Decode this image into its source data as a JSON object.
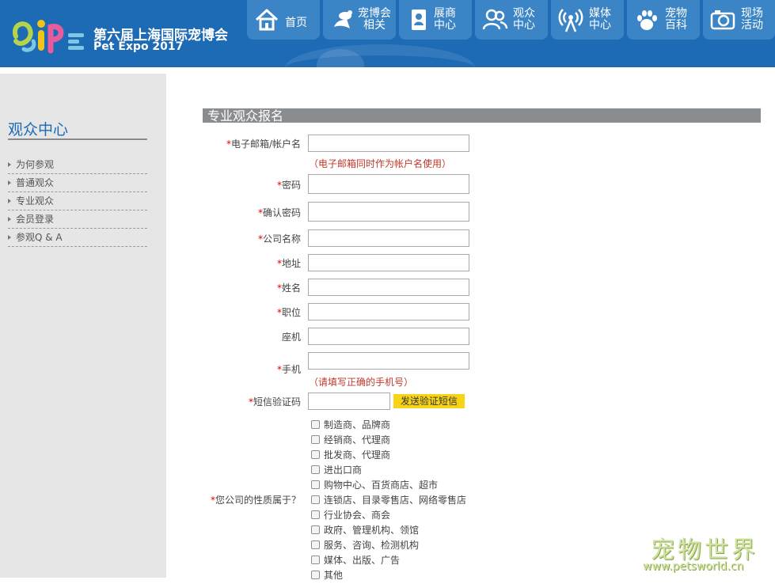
{
  "header": {
    "logo_text": "SiP",
    "title": "第六届上海国际宠博会",
    "subtitle": "Pet Expo 2017",
    "colors": {
      "bar": "#1d6ab5",
      "tab": "#3b84c6"
    }
  },
  "nav": [
    {
      "id": "home",
      "line1": "首页",
      "line2": "",
      "icon": "house-icon"
    },
    {
      "id": "expo",
      "line1": "宠博会",
      "line2": "相关",
      "icon": "pet-expo-icon"
    },
    {
      "id": "exhibitor",
      "line1": "展商",
      "line2": "中心",
      "icon": "badge-icon"
    },
    {
      "id": "visitor",
      "line1": "观众",
      "line2": "中心",
      "icon": "people-icon"
    },
    {
      "id": "media",
      "line1": "媒体",
      "line2": "中心",
      "icon": "broadcast-icon"
    },
    {
      "id": "wiki",
      "line1": "宠物",
      "line2": "百科",
      "icon": "paw-icon"
    },
    {
      "id": "events",
      "line1": "现场",
      "line2": "活动",
      "icon": "camera-icon"
    }
  ],
  "sidebar": {
    "title": "观众中心",
    "items": [
      {
        "label": "为何参观"
      },
      {
        "label": "普通观众"
      },
      {
        "label": "专业观众"
      },
      {
        "label": "会员登录"
      },
      {
        "label": "参观Q & A"
      }
    ]
  },
  "form": {
    "section_title": "专业观众报名",
    "required_mark": "*",
    "fields": {
      "email": {
        "label": "电子邮箱/帐户名",
        "value": "",
        "hint": "（电子邮箱同时作为帐户名使用）"
      },
      "password": {
        "label": "密码",
        "value": ""
      },
      "confirm_password": {
        "label": "确认密码",
        "value": ""
      },
      "company": {
        "label": "公司名称",
        "value": ""
      },
      "address": {
        "label": "地址",
        "value": ""
      },
      "name": {
        "label": "姓名",
        "value": ""
      },
      "position": {
        "label": "职位",
        "value": ""
      },
      "landline": {
        "label": "座机",
        "value": ""
      },
      "mobile": {
        "label": "手机",
        "value": "",
        "hint": "（请填写正确的手机号）"
      },
      "sms_code": {
        "label": "短信验证码",
        "value": ""
      }
    },
    "sms_button": "发送验证短信",
    "company_type": {
      "label": "您公司的性质属于？",
      "options": [
        "制造商、品牌商",
        "经销商、代理商",
        "批发商、代理商",
        "进出口商",
        "购物中心、百货商店、超市",
        "连锁店、目录零售店、网络零售店",
        "行业协会、商会",
        "政府、管理机构、领馆",
        "服务、咨询、检测机构",
        "媒体、出版、广告",
        "其他"
      ]
    }
  },
  "watermark": {
    "text": "宠物世界",
    "url": "www.petsworld.cn"
  }
}
